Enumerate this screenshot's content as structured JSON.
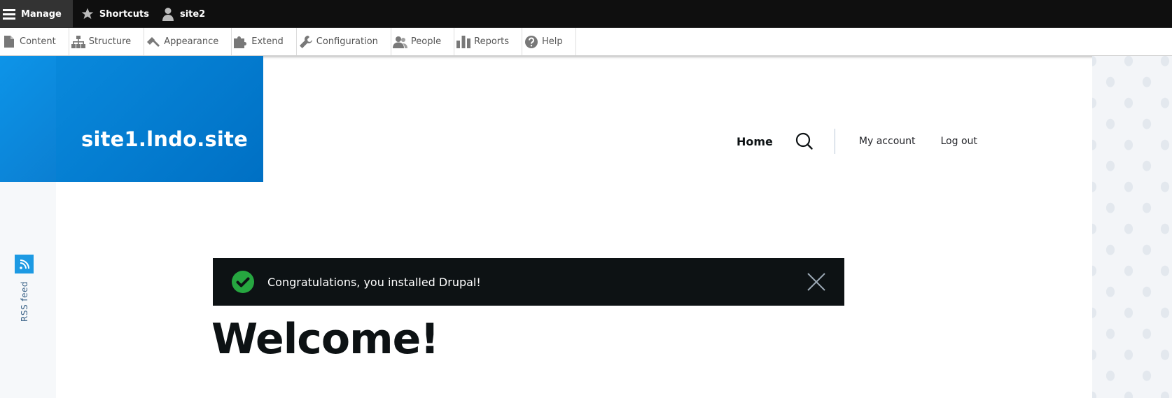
{
  "toolbar": {
    "manage_label": "Manage",
    "shortcuts_label": "Shortcuts",
    "user_label": "site2"
  },
  "admin_menu": {
    "items": [
      {
        "label": "Content",
        "icon": "page-icon"
      },
      {
        "label": "Structure",
        "icon": "sitemap-icon"
      },
      {
        "label": "Appearance",
        "icon": "paintbrush-icon"
      },
      {
        "label": "Extend",
        "icon": "puzzle-icon"
      },
      {
        "label": "Configuration",
        "icon": "wrench-icon"
      },
      {
        "label": "People",
        "icon": "people-icon"
      },
      {
        "label": "Reports",
        "icon": "bar-chart-icon"
      },
      {
        "label": "Help",
        "icon": "help-icon"
      }
    ]
  },
  "site": {
    "name": "site1.lndo.site"
  },
  "main_nav": {
    "home": "Home",
    "my_account": "My account",
    "log_out": "Log out"
  },
  "rss": {
    "label": "RSS feed"
  },
  "message": {
    "text": "Congratulations, you installed Drupal!"
  },
  "page": {
    "title": "Welcome!"
  },
  "colors": {
    "toolbar_bg": "#0f0f0f",
    "manage_bg": "#333333",
    "brand_blue": "#0078cf",
    "message_bg": "#0d1214",
    "success_green": "#26a640"
  }
}
